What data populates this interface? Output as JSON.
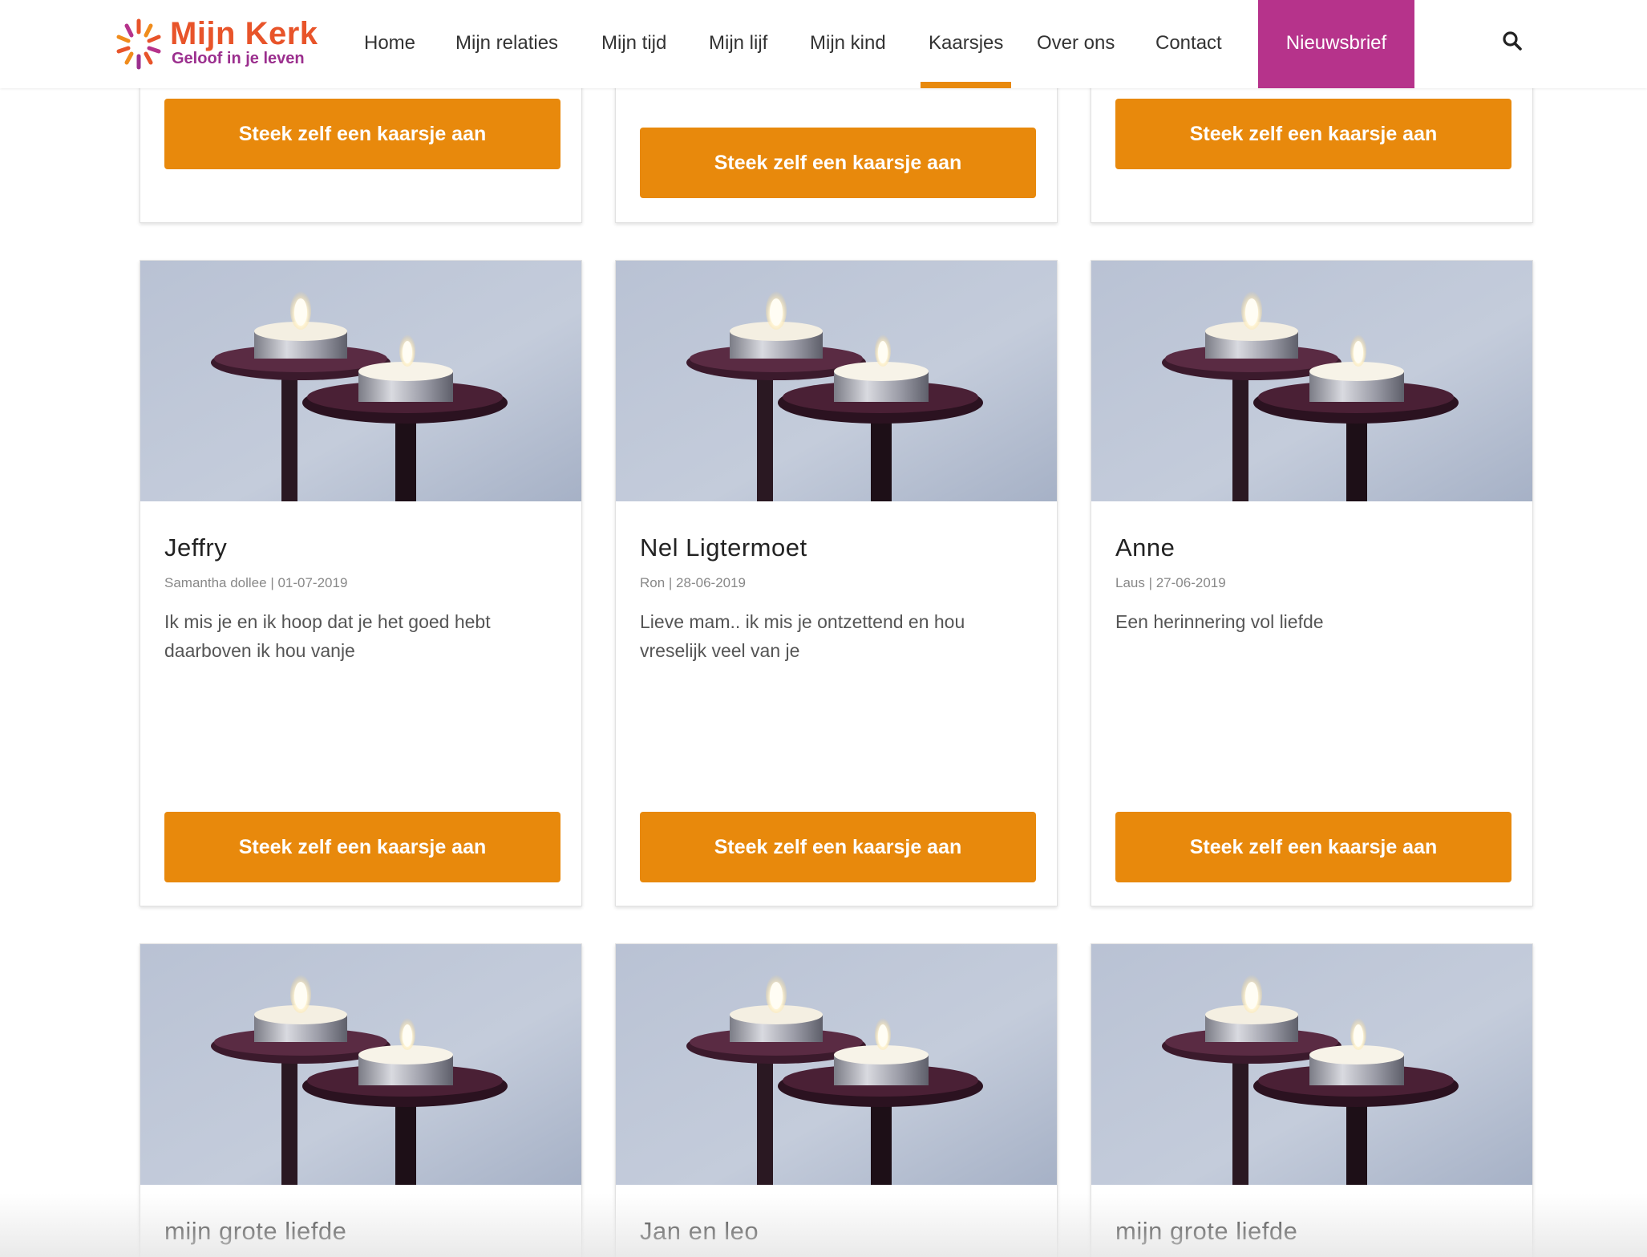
{
  "header": {
    "logo_brand": "Mijn Kerk",
    "logo_tagline": "Geloof in je leven",
    "nav": [
      {
        "label": "Home"
      },
      {
        "label": "Mijn relaties"
      },
      {
        "label": "Mijn tijd"
      },
      {
        "label": "Mijn lijf"
      },
      {
        "label": "Mijn kind"
      },
      {
        "label": "Kaarsjes",
        "active": true
      },
      {
        "label": "Over ons"
      },
      {
        "label": "Contact"
      }
    ],
    "newsletter_label": "Nieuwsbrief",
    "search_icon": "search-icon"
  },
  "colors": {
    "accent_orange": "#e8890c",
    "newsletter_purple": "#b6338b",
    "brand_orange": "#e8542a",
    "brand_purple": "#9b2f8e"
  },
  "cards_top_row": [
    {
      "button": "Steek zelf een kaarsje aan"
    },
    {
      "button": "Steek zelf een kaarsje aan"
    },
    {
      "button": "Steek zelf een kaarsje aan"
    }
  ],
  "cards_middle_row": [
    {
      "title": "Jeffry",
      "meta": "Samantha dollee | 01-07-2019",
      "text": "Ik mis je en ik hoop dat je het goed hebt daarboven ik hou vanje",
      "button": "Steek zelf een kaarsje aan"
    },
    {
      "title": "Nel Ligtermoet",
      "meta": "Ron | 28-06-2019",
      "text": "Lieve mam.. ik mis je ontzettend en hou vreselijk veel van je",
      "button": "Steek zelf een kaarsje aan"
    },
    {
      "title": "Anne",
      "meta": "Laus | 27-06-2019",
      "text": "Een herinnering vol liefde",
      "button": "Steek zelf een kaarsje aan"
    }
  ],
  "cards_bottom_row": [
    {
      "title": "mijn grote liefde"
    },
    {
      "title": "Jan en leo"
    },
    {
      "title": "mijn grote liefde"
    }
  ]
}
